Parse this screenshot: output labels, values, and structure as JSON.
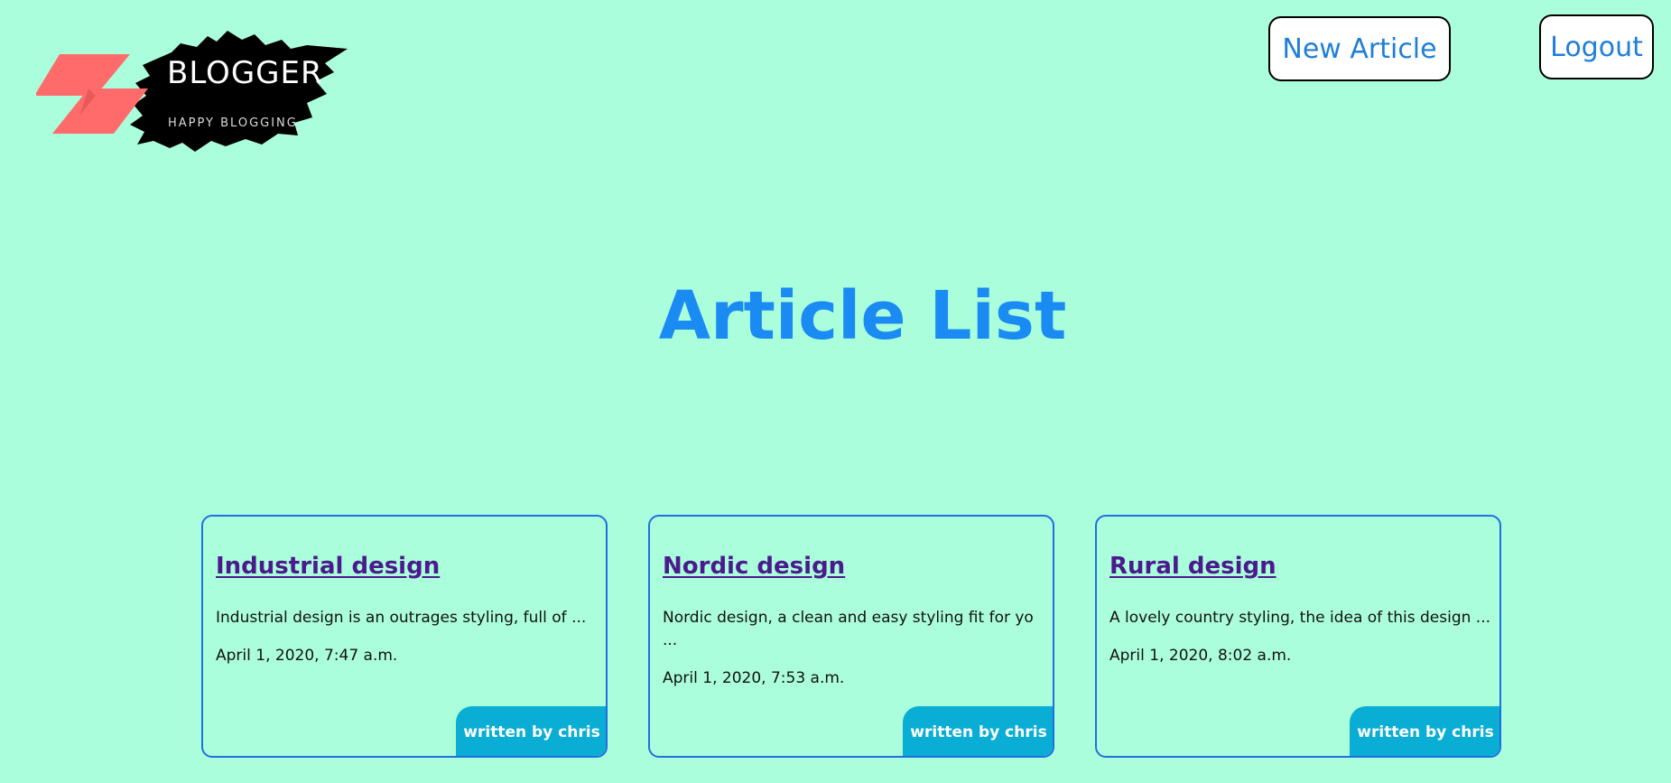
{
  "logo": {
    "title": "BLOGGER",
    "tagline": "HAPPY BLOGGING",
    "colors": {
      "shape": "#ff6b6b",
      "splash": "#000000"
    }
  },
  "header": {
    "new_article_label": "New Article",
    "logout_label": "Logout"
  },
  "page": {
    "title": "Article List"
  },
  "articles": [
    {
      "title": "Industrial design",
      "excerpt": "Industrial design is an outrages styling, full of ...",
      "date": "April 1, 2020, 7:47 a.m.",
      "author_label": "written by chris"
    },
    {
      "title": "Nordic design",
      "excerpt": "Nordic design, a clean and easy styling fit for yo ...",
      "date": "April 1, 2020, 7:53 a.m.",
      "author_label": "written by chris"
    },
    {
      "title": "Rural design",
      "excerpt": "A lovely country styling, the idea of this design ...",
      "date": "April 1, 2020, 8:02 a.m.",
      "author_label": "written by chris"
    }
  ],
  "colors": {
    "background": "#abfedb",
    "accent": "#1a8bf2",
    "card_border": "#1f6fe0",
    "author_badge": "#0aaed4",
    "link": "#4b1a8c"
  }
}
